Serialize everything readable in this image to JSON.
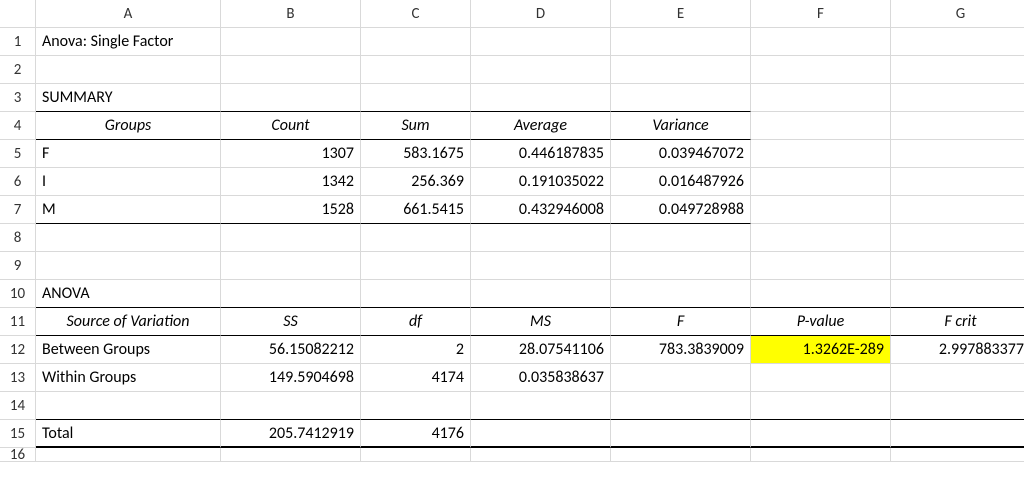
{
  "col_headers": [
    "A",
    "B",
    "C",
    "D",
    "E",
    "F",
    "G"
  ],
  "row_headers": [
    1,
    2,
    3,
    4,
    5,
    6,
    7,
    8,
    9,
    10,
    11,
    12,
    13,
    14,
    15,
    16
  ],
  "r1": {
    "a": "Anova: Single Factor"
  },
  "r3": {
    "a": "SUMMARY"
  },
  "r4": {
    "a": "Groups",
    "b": "Count",
    "c": "Sum",
    "d": "Average",
    "e": "Variance"
  },
  "r5": {
    "a": "F",
    "b": "1307",
    "c": "583.1675",
    "d": "0.446187835",
    "e": "0.039467072"
  },
  "r6": {
    "a": "I",
    "b": "1342",
    "c": "256.369",
    "d": "0.191035022",
    "e": "0.016487926"
  },
  "r7": {
    "a": "M",
    "b": "1528",
    "c": "661.5415",
    "d": "0.432946008",
    "e": "0.049728988"
  },
  "r10": {
    "a": "ANOVA"
  },
  "r11": {
    "a": "Source of Variation",
    "b": "SS",
    "c": "df",
    "d": "MS",
    "e": "F",
    "f": "P-value",
    "g": "F crit"
  },
  "r12": {
    "a": "Between Groups",
    "b": "56.15082212",
    "c": "2",
    "d": "28.07541106",
    "e": "783.3839009",
    "f": "1.3262E-289",
    "g": "2.997883377"
  },
  "r13": {
    "a": "Within Groups",
    "b": "149.5904698",
    "c": "4174",
    "d": "0.035838637"
  },
  "r15": {
    "a": "Total",
    "b": "205.7412919",
    "c": "4176"
  }
}
